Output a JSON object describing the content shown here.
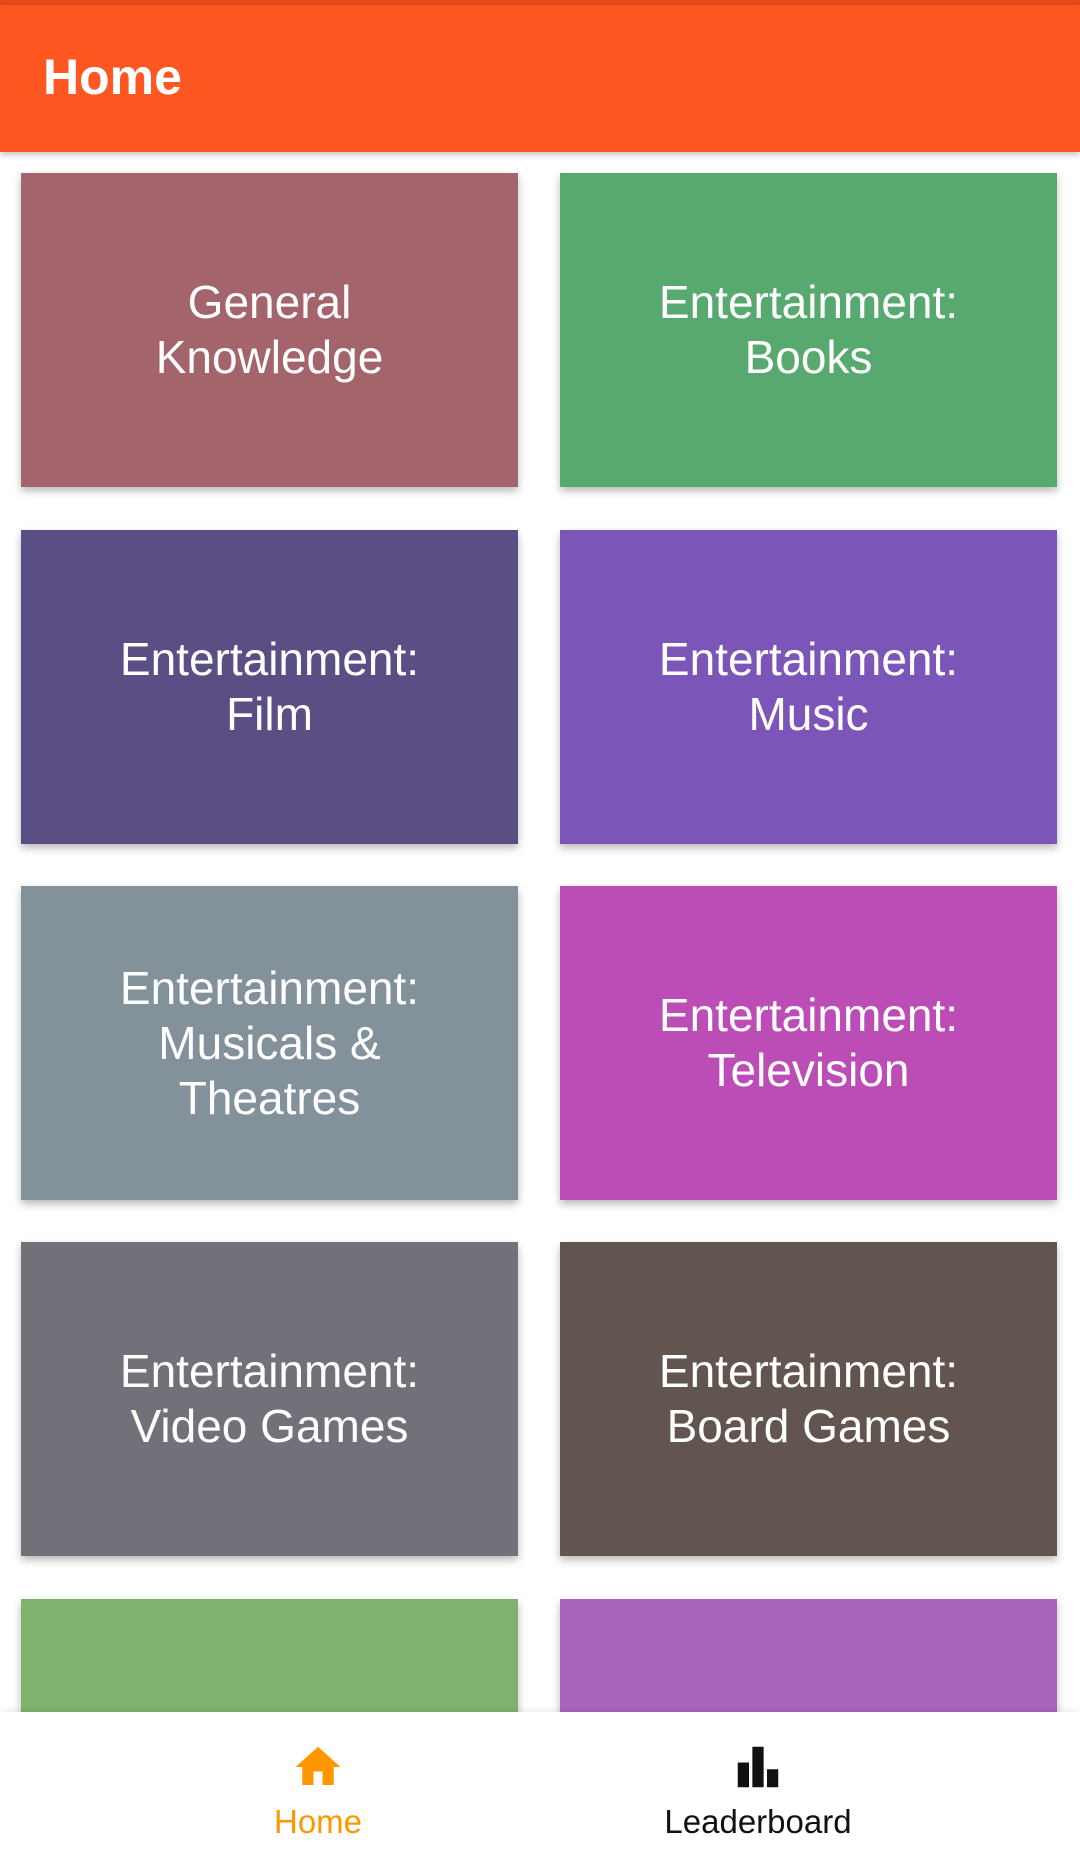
{
  "app_bar": {
    "title": "Home"
  },
  "colors": {
    "app_bar": "#ff5722",
    "nav_active": "#ff9800",
    "nav_inactive": "#111111"
  },
  "categories": [
    {
      "label": "General Knowledge",
      "color": "#a3646c"
    },
    {
      "label": "Entertainment: Books",
      "color": "#58a96f"
    },
    {
      "label": "Entertainment: Film",
      "color": "#5b4e85"
    },
    {
      "label": "Entertainment: Music",
      "color": "#7c55b8"
    },
    {
      "label": "Entertainment: Musicals & Theatres",
      "color": "#83919a"
    },
    {
      "label": "Entertainment: Television",
      "color": "#bc4db6"
    },
    {
      "label": "Entertainment: Video Games",
      "color": "#727179"
    },
    {
      "label": "Entertainment: Board Games",
      "color": "#62544f"
    },
    {
      "label": "",
      "color": "#7fb26f"
    },
    {
      "label": "",
      "color": "#a865bb"
    }
  ],
  "bottom_nav": {
    "home_label": "Home",
    "home_icon": "home-icon",
    "leaderboard_label": "Leaderboard",
    "leaderboard_icon": "bar-chart-icon",
    "active": "home"
  }
}
